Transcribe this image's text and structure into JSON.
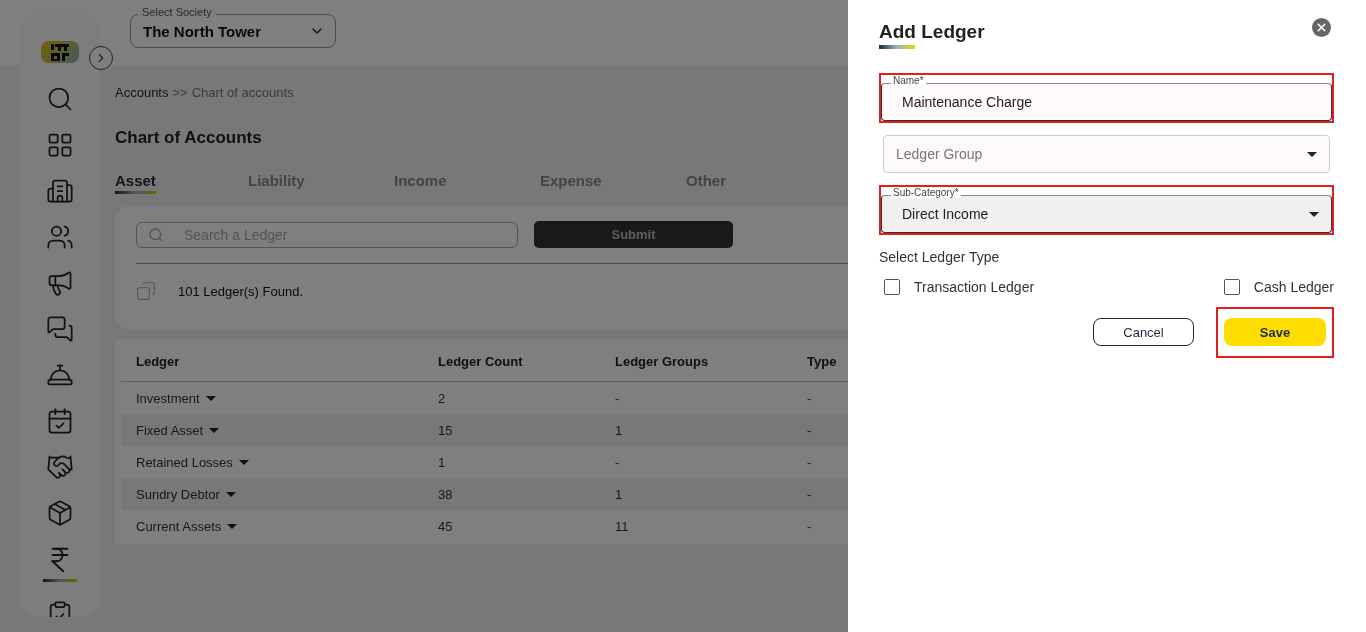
{
  "header": {
    "society_label": "Select Society",
    "society": "The North Tower"
  },
  "sidebar": {
    "items": [
      {
        "selected": false
      },
      {
        "selected": false
      },
      {
        "selected": false
      },
      {
        "selected": false
      },
      {
        "selected": false
      },
      {
        "selected": false
      },
      {
        "selected": false
      },
      {
        "selected": false
      },
      {
        "selected": false
      },
      {
        "selected": false
      },
      {
        "selected": true
      },
      {
        "selected": false
      }
    ]
  },
  "breadcrumb": {
    "parent": "Accounts",
    "separator": ">>",
    "current": "Chart of accounts"
  },
  "page_title": "Chart of Accounts",
  "tabs": [
    {
      "label": "Asset",
      "selected": true
    },
    {
      "label": "Liability",
      "selected": false
    },
    {
      "label": "Income",
      "selected": false
    },
    {
      "label": "Expense",
      "selected": false
    },
    {
      "label": "Other",
      "selected": false
    }
  ],
  "search": {
    "placeholder": "Search a Ledger",
    "button": "Submit"
  },
  "result_count": "101 Ledger(s) Found.",
  "table": {
    "columns": [
      "Ledger",
      "Ledger Count",
      "Ledger Groups",
      "Type"
    ],
    "rows": [
      {
        "cells": [
          "Investment",
          "2",
          "-",
          "-"
        ]
      },
      {
        "cells": [
          "Fixed Asset",
          "15",
          "1",
          "-"
        ]
      },
      {
        "cells": [
          "Retained Losses",
          "1",
          "-",
          "-"
        ]
      },
      {
        "cells": [
          "Sundry Debtor",
          "38",
          "1",
          "-"
        ]
      },
      {
        "cells": [
          "Current Assets",
          "45",
          "11",
          "-"
        ]
      }
    ]
  },
  "drawer": {
    "title": "Add Ledger",
    "fields": [
      {
        "kind": "text",
        "label": "Name*",
        "value": "Maintenance Charge",
        "highlighted": true
      },
      {
        "kind": "select",
        "placeholder": "Ledger Group",
        "highlighted": false
      },
      {
        "kind": "select",
        "label": "Sub-Category*",
        "value": "Direct Income",
        "highlighted": true
      }
    ],
    "ledger_type_label": "Select Ledger Type",
    "options": [
      {
        "label": "Transaction Ledger",
        "checked": false
      },
      {
        "label": "Cash Ledger",
        "checked": false
      }
    ],
    "buttons": [
      {
        "kind": "secondary",
        "label": "Cancel",
        "highlighted": false
      },
      {
        "kind": "primary",
        "label": "Save",
        "highlighted": true
      }
    ]
  }
}
